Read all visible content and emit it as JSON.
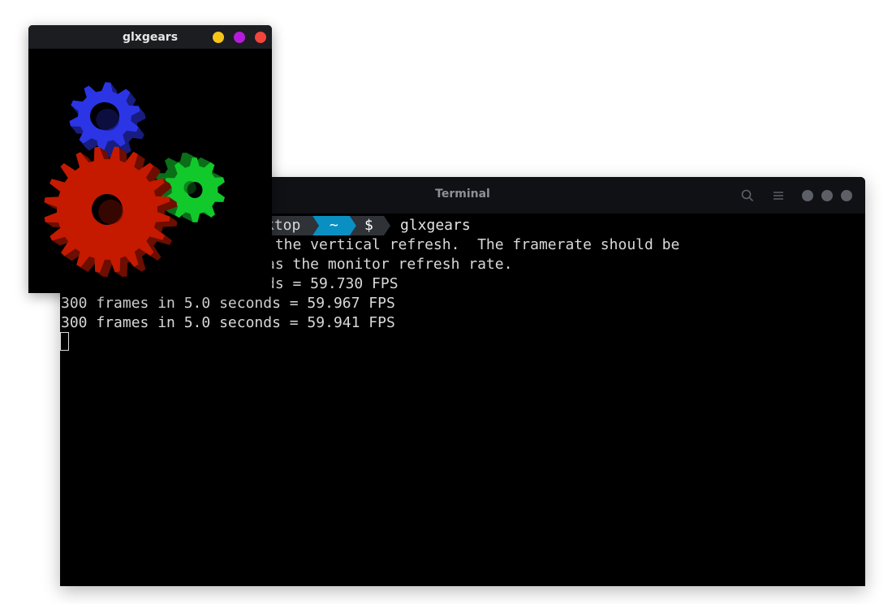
{
  "terminal": {
    "title": "Terminal",
    "prompt": {
      "dir_fragment": "ktop",
      "home": "~",
      "symbol": "$",
      "command": "glxgears"
    },
    "output": [
      " the vertical refresh.  The framerate should be",
      "as the monitor refresh rate.",
      "ds = 59.730 FPS",
      "300 frames in 5.0 seconds = 59.967 FPS",
      "300 frames in 5.0 seconds = 59.941 FPS"
    ],
    "colors": {
      "prompt_bg": "#2f3237",
      "home_bg": "#0a8fc2",
      "prompt_symbol_bg": "#2f3237"
    }
  },
  "glxgears": {
    "title": "glxgears",
    "buttons": {
      "minimize": "#f5c518",
      "maximize": "#b41cd9",
      "close": "#f2453d"
    },
    "gears": [
      {
        "name": "red-gear",
        "color": "#c51a00"
      },
      {
        "name": "green-gear",
        "color": "#12c92b"
      },
      {
        "name": "blue-gear",
        "color": "#2b35e6"
      }
    ]
  }
}
